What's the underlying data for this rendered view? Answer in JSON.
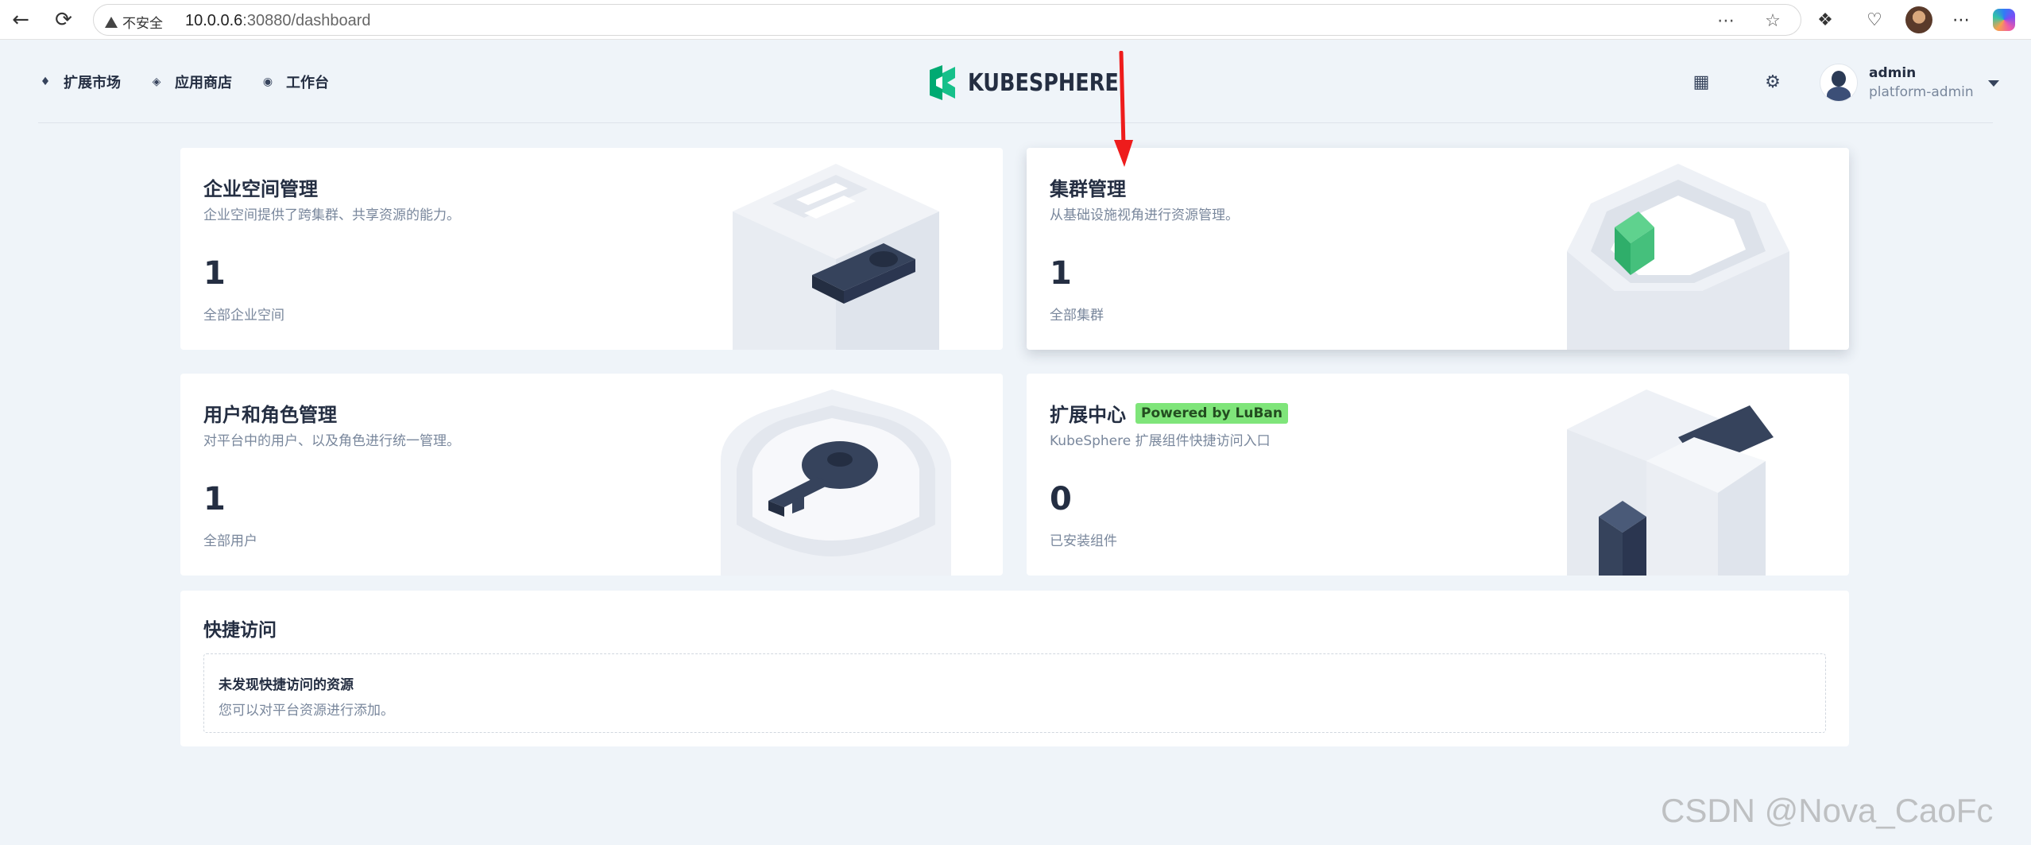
{
  "browser": {
    "security_label": "不安全",
    "url_host": "10.0.0.6",
    "url_rest": ":30880/dashboard"
  },
  "header": {
    "nav": [
      {
        "label": "扩展市场",
        "icon": "extension-market-icon"
      },
      {
        "label": "应用商店",
        "icon": "app-store-icon"
      },
      {
        "label": "工作台",
        "icon": "workbench-icon"
      }
    ],
    "logo_text": "KUBESPHERE",
    "user": {
      "name": "admin",
      "role": "platform-admin"
    },
    "colors": {
      "brand": "#00aa72",
      "text": "#242e42",
      "muted": "#79879c"
    }
  },
  "cards": {
    "workspace": {
      "title": "企业空间管理",
      "desc": "企业空间提供了跨集群、共享资源的能力。",
      "count": "1",
      "count_label": "全部企业空间"
    },
    "cluster": {
      "title": "集群管理",
      "desc": "从基础设施视角进行资源管理。",
      "count": "1",
      "count_label": "全部集群"
    },
    "users": {
      "title": "用户和角色管理",
      "desc": "对平台中的用户、以及角色进行统一管理。",
      "count": "1",
      "count_label": "全部用户"
    },
    "extensions": {
      "title": "扩展中心",
      "badge": "Powered by LuBan",
      "desc": "KubeSphere 扩展组件快捷访问入口",
      "count": "0",
      "count_label": "已安装组件"
    }
  },
  "quick_access": {
    "title": "快捷访问",
    "empty_title": "未发现快捷访问的资源",
    "empty_desc": "您可以对平台资源进行添加。"
  },
  "watermark": "CSDN @Nova_CaoFc"
}
